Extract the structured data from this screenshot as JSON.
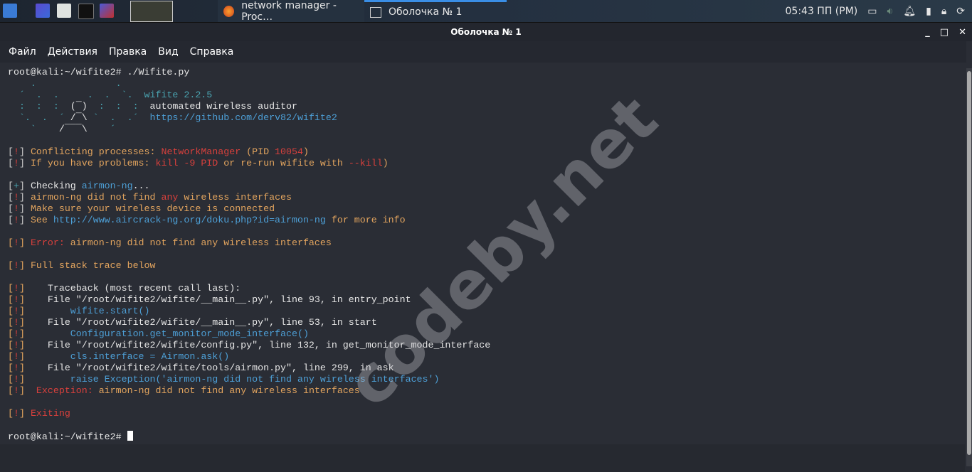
{
  "taskbar": {
    "tasks": [
      {
        "label": "network manager - Proc…",
        "icon": "firefox-icon"
      },
      {
        "label": "Оболочка № 1",
        "icon": "terminal-icon"
      }
    ],
    "clock": "05:43 ПП (PM)"
  },
  "window": {
    "title": "Оболочка № 1"
  },
  "menu": [
    "Файл",
    "Действия",
    "Правка",
    "Вид",
    "Справка"
  ],
  "watermark": "codeby.net",
  "colors": {
    "orange": "#e2a45e",
    "red": "#d8403c",
    "blue": "#4d9fd6",
    "teal": "#4aa3b0"
  },
  "terminal": {
    "lines": [
      [
        [
          "w",
          "root@kali:~/wifite2# ./Wifite.py"
        ]
      ],
      [
        [
          "t",
          "    .              .    "
        ]
      ],
      [
        [
          "t",
          "  ´  .  .     .  .  `.  "
        ],
        [
          "t",
          "wifite 2.2.5"
        ]
      ],
      [
        [
          "t",
          "  :  :  :  "
        ],
        [
          "w",
          "(¯)"
        ],
        [
          "t",
          "  :  :  :  "
        ],
        [
          "w",
          "automated wireless auditor"
        ]
      ],
      [
        [
          "t",
          "  `.  .  ´ "
        ],
        [
          "w",
          "/¯\\"
        ],
        [
          "t",
          " `  .  .´  "
        ],
        [
          "b",
          "https://github.com/derv82/wifite2"
        ]
      ],
      [
        [
          "t",
          "    `    "
        ],
        [
          "w",
          "/¯¯¯\\"
        ],
        [
          "t",
          "    ´     "
        ]
      ],
      [],
      [
        [
          "g",
          "["
        ],
        [
          "r",
          "!"
        ],
        [
          "g",
          "] "
        ],
        [
          "o",
          "Conflicting processes: "
        ],
        [
          "r",
          "NetworkManager"
        ],
        [
          "o",
          " (PID "
        ],
        [
          "r",
          "10054"
        ],
        [
          "o",
          ")"
        ]
      ],
      [
        [
          "g",
          "["
        ],
        [
          "r",
          "!"
        ],
        [
          "g",
          "] "
        ],
        [
          "o",
          "If you have problems: "
        ],
        [
          "r",
          "kill -9 PID"
        ],
        [
          "o",
          " or re-run wifite with "
        ],
        [
          "r",
          "--kill"
        ],
        [
          "o",
          ")"
        ]
      ],
      [],
      [
        [
          "g",
          "["
        ],
        [
          "t",
          "+"
        ],
        [
          "g",
          "] "
        ],
        [
          "w",
          "Checking "
        ],
        [
          "b",
          "airmon-ng"
        ],
        [
          "w",
          "..."
        ]
      ],
      [
        [
          "g",
          "["
        ],
        [
          "r",
          "!"
        ],
        [
          "g",
          "] "
        ],
        [
          "o",
          "airmon-ng did not find "
        ],
        [
          "r",
          "any"
        ],
        [
          "o",
          " wireless interfaces"
        ]
      ],
      [
        [
          "g",
          "["
        ],
        [
          "r",
          "!"
        ],
        [
          "g",
          "] "
        ],
        [
          "o",
          "Make sure your wireless device is connected"
        ]
      ],
      [
        [
          "g",
          "["
        ],
        [
          "r",
          "!"
        ],
        [
          "g",
          "] "
        ],
        [
          "o",
          "See "
        ],
        [
          "b",
          "http://www.aircrack-ng.org/doku.php?id=airmon-ng"
        ],
        [
          "o",
          " for more info"
        ]
      ],
      [],
      [
        [
          "o",
          "["
        ],
        [
          "r",
          "!"
        ],
        [
          "o",
          "] "
        ],
        [
          "r",
          "Error: "
        ],
        [
          "o",
          "airmon-ng did not find any wireless interfaces"
        ]
      ],
      [],
      [
        [
          "o",
          "["
        ],
        [
          "r",
          "!"
        ],
        [
          "o",
          "] "
        ],
        [
          "o",
          "Full stack trace below"
        ]
      ],
      [],
      [
        [
          "o",
          "["
        ],
        [
          "r",
          "!"
        ],
        [
          "o",
          "]    "
        ],
        [
          "w",
          "Traceback (most recent call last):"
        ]
      ],
      [
        [
          "o",
          "["
        ],
        [
          "r",
          "!"
        ],
        [
          "o",
          "]    "
        ],
        [
          "w",
          "File \"/root/wifite2/wifite/__main__.py\", line 93, in entry_point"
        ]
      ],
      [
        [
          "o",
          "["
        ],
        [
          "r",
          "!"
        ],
        [
          "o",
          "]        "
        ],
        [
          "b",
          "wifite.start()"
        ]
      ],
      [
        [
          "o",
          "["
        ],
        [
          "r",
          "!"
        ],
        [
          "o",
          "]    "
        ],
        [
          "w",
          "File \"/root/wifite2/wifite/__main__.py\", line 53, in start"
        ]
      ],
      [
        [
          "o",
          "["
        ],
        [
          "r",
          "!"
        ],
        [
          "o",
          "]        "
        ],
        [
          "b",
          "Configuration.get_monitor_mode_interface()"
        ]
      ],
      [
        [
          "o",
          "["
        ],
        [
          "r",
          "!"
        ],
        [
          "o",
          "]    "
        ],
        [
          "w",
          "File \"/root/wifite2/wifite/config.py\", line 132, in get_monitor_mode_interface"
        ]
      ],
      [
        [
          "o",
          "["
        ],
        [
          "r",
          "!"
        ],
        [
          "o",
          "]        "
        ],
        [
          "b",
          "cls.interface = Airmon.ask()"
        ]
      ],
      [
        [
          "o",
          "["
        ],
        [
          "r",
          "!"
        ],
        [
          "o",
          "]    "
        ],
        [
          "w",
          "File \"/root/wifite2/wifite/tools/airmon.py\", line 299, in ask"
        ]
      ],
      [
        [
          "o",
          "["
        ],
        [
          "r",
          "!"
        ],
        [
          "o",
          "]        "
        ],
        [
          "b",
          "raise Exception('airmon-ng did not find any wireless interfaces')"
        ]
      ],
      [
        [
          "o",
          "["
        ],
        [
          "r",
          "!"
        ],
        [
          "o",
          "]  "
        ],
        [
          "r",
          "Exception: "
        ],
        [
          "o",
          "airmon-ng did not find any wireless interfaces"
        ]
      ],
      [],
      [
        [
          "o",
          "["
        ],
        [
          "r",
          "!"
        ],
        [
          "o",
          "] "
        ],
        [
          "r",
          "Exiting"
        ]
      ],
      [],
      [
        [
          "w",
          "root@kali:~/wifite2# "
        ]
      ]
    ]
  }
}
